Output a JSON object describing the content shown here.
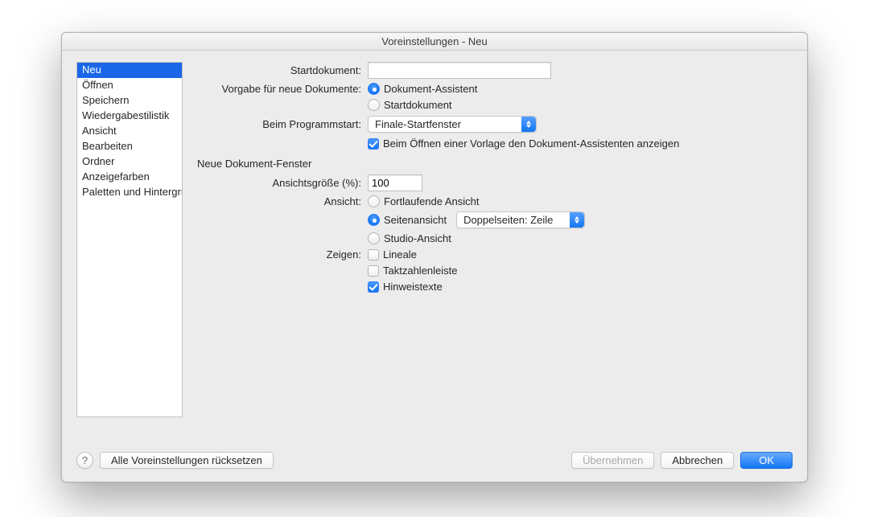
{
  "titlebar": "Voreinstellungen - Neu",
  "sidebar": {
    "items": [
      "Neu",
      "Öffnen",
      "Speichern",
      "Wiedergabestilistik",
      "Ansicht",
      "Bearbeiten",
      "Ordner",
      "Anzeigefarben",
      "Paletten und Hintergründe"
    ],
    "selected_index": 0
  },
  "form": {
    "startdokument_label": "Startdokument:",
    "startdokument_value": "",
    "vorgabe_label": "Vorgabe für neue Dokumente:",
    "vorgabe_opt1": "Dokument-Assistent",
    "vorgabe_opt2": "Startdokument",
    "programmstart_label": "Beim Programmstart:",
    "programmstart_value": "Finale-Startfenster",
    "vorlage_checkbox": "Beim Öffnen einer Vorlage den Dokument-Assistenten anzeigen",
    "section_header": "Neue Dokument-Fenster",
    "ansichtsgroesse_label": "Ansichtsgröße (%):",
    "ansichtsgroesse_value": "100",
    "ansicht_label": "Ansicht:",
    "ansicht_opt1": "Fortlaufende Ansicht",
    "ansicht_opt2": "Seitenansicht",
    "ansicht_opt3": "Studio-Ansicht",
    "seitenansicht_popup": "Doppelseiten: Zeile",
    "zeigen_label": "Zeigen:",
    "zeigen_opt1": "Lineale",
    "zeigen_opt2": "Taktzahlenleiste",
    "zeigen_opt3": "Hinweistexte"
  },
  "footer": {
    "help_glyph": "?",
    "reset": "Alle Voreinstellungen rücksetzen",
    "apply": "Übernehmen",
    "cancel": "Abbrechen",
    "ok": "OK"
  }
}
